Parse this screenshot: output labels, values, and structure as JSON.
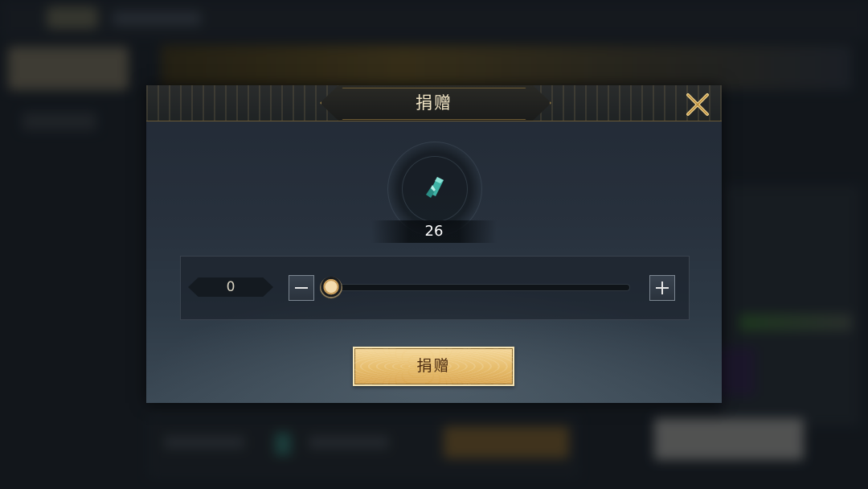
{
  "dialog": {
    "title": "捐赠",
    "item": {
      "icon": "green-crystal-icon",
      "count": "26"
    },
    "amount": {
      "value": "0",
      "slider_fraction": 0
    },
    "donate_label": "捐赠"
  },
  "colors": {
    "title_text": "#f3e6c6",
    "button_gold": "#e7bd6c",
    "button_text": "#4a2a10",
    "frame_gold": "#8c7442"
  }
}
